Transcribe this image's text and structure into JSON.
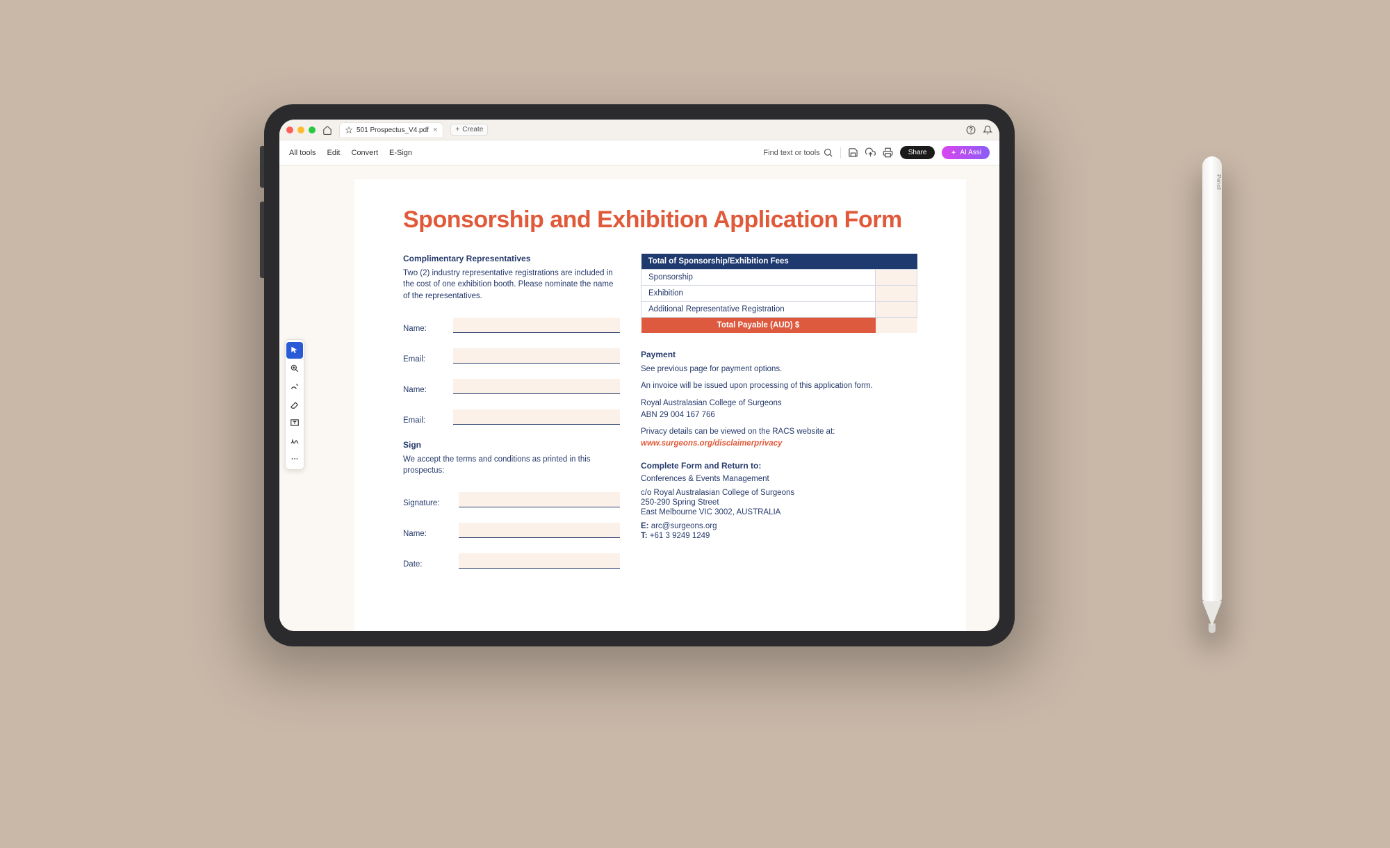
{
  "tabbar": {
    "star_icon": "star",
    "doc_title": "501 Prospectus_V4.pdf",
    "new_tab_label": "Create"
  },
  "toolbar": {
    "all_tools": "All tools",
    "edit": "Edit",
    "convert": "Convert",
    "esign": "E-Sign",
    "search_placeholder": "Find text or tools",
    "share": "Share",
    "ai_assist": "AI Assi"
  },
  "page": {
    "title": "Sponsorship and Exhibition Application Form",
    "left": {
      "reps_head": "Complimentary Representatives",
      "reps_body": "Two (2) industry representative registrations are included in the cost of one exhibition booth. Please nominate the name of the representatives.",
      "name_label": "Name:",
      "email_label": "Email:",
      "sign_head": "Sign",
      "sign_body": "We accept the terms and conditions as printed in this prospectus:",
      "signature_label": "Signature:",
      "date_label": "Date:"
    },
    "right": {
      "fees": {
        "header": "Total of Sponsorship/Exhibition Fees",
        "rows": [
          "Sponsorship",
          "Exhibition",
          "Additional Representative Registration"
        ],
        "total_label": "Total Payable (AUD) $"
      },
      "payment_head": "Payment",
      "payment_l1": "See previous page for payment options.",
      "payment_l2": "An invoice will be issued upon processing of this application form.",
      "org_name": "Royal Australasian College of Surgeons",
      "org_abn": "ABN 29 004 167 766",
      "privacy_lead": "Privacy details can be viewed on the RACS website at:",
      "privacy_url": "www.surgeons.org/disclaimerprivacy",
      "return_head": "Complete Form and Return to:",
      "return_l1": "Conferences & Events Management",
      "return_l2": "c/o Royal Australasian College of Surgeons",
      "return_l3": "250-290 Spring Street",
      "return_l4": "East Melbourne VIC 3002, AUSTRALIA",
      "email_prefix": "E: ",
      "email_val": "arc@surgeons.org",
      "tel_prefix": "T: ",
      "tel_val": "+61 3 9249 1249"
    }
  },
  "pencil_label": " Pencil"
}
